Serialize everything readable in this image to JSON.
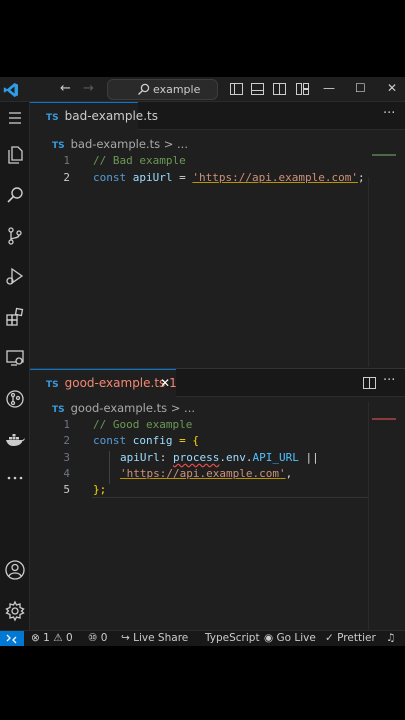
{
  "titlebar": {
    "search_text": "example",
    "back_arrow": "←",
    "forward_arrow": "→",
    "minimize": "—",
    "maximize": "☐",
    "close": "✕"
  },
  "activity_icons": [
    "menu-icon",
    "explorer-icon",
    "search-icon",
    "source-control-icon",
    "run-debug-icon",
    "extensions-icon",
    "remote-explorer-icon",
    "git-graph-icon",
    "docker-icon",
    "more-icon",
    "account-icon",
    "settings-icon"
  ],
  "top_editor": {
    "tab_label": "bad-example.ts",
    "tab_badge": "TS",
    "breadcrumb": "bad-example.ts > ...",
    "more_actions": "···",
    "lines": [
      {
        "number": "1",
        "text": "// Bad example"
      },
      {
        "number": "2",
        "keyword": "const",
        "var": "apiUrl",
        "op": " = ",
        "str": "'https://api.example.com'",
        "end": ";"
      }
    ]
  },
  "bottom_editor": {
    "tab_label": "good-example.ts 1",
    "tab_badge": "TS",
    "tab_close": "✕",
    "breadcrumb": "good-example.ts > ...",
    "more_actions": "···",
    "lines": [
      {
        "number": "1",
        "text": "// Good example"
      },
      {
        "number": "2",
        "keyword": "const",
        "var": "config",
        "rest": " = {"
      },
      {
        "number": "3",
        "prop": "apiUrl",
        "colon": ": ",
        "obj": "process",
        "dot1": ".",
        "env": "env",
        "dot2": ".",
        "const": "API_URL",
        "op": " ||"
      },
      {
        "number": "4",
        "str": "'https://api.example.com'",
        "end": ","
      },
      {
        "number": "5",
        "text": "};"
      }
    ]
  },
  "statusbar": {
    "errors": "1",
    "warnings": "0",
    "ports": "0",
    "live_share": "Live Share",
    "language": "TypeScript",
    "go_live": "Go Live",
    "prettier": "Prettier"
  },
  "colors": {
    "accent": "#0078d4",
    "editor_bg": "#1f1f1f",
    "keyword": "#569cd6",
    "string": "#ce9178",
    "comment": "#6a9955"
  }
}
